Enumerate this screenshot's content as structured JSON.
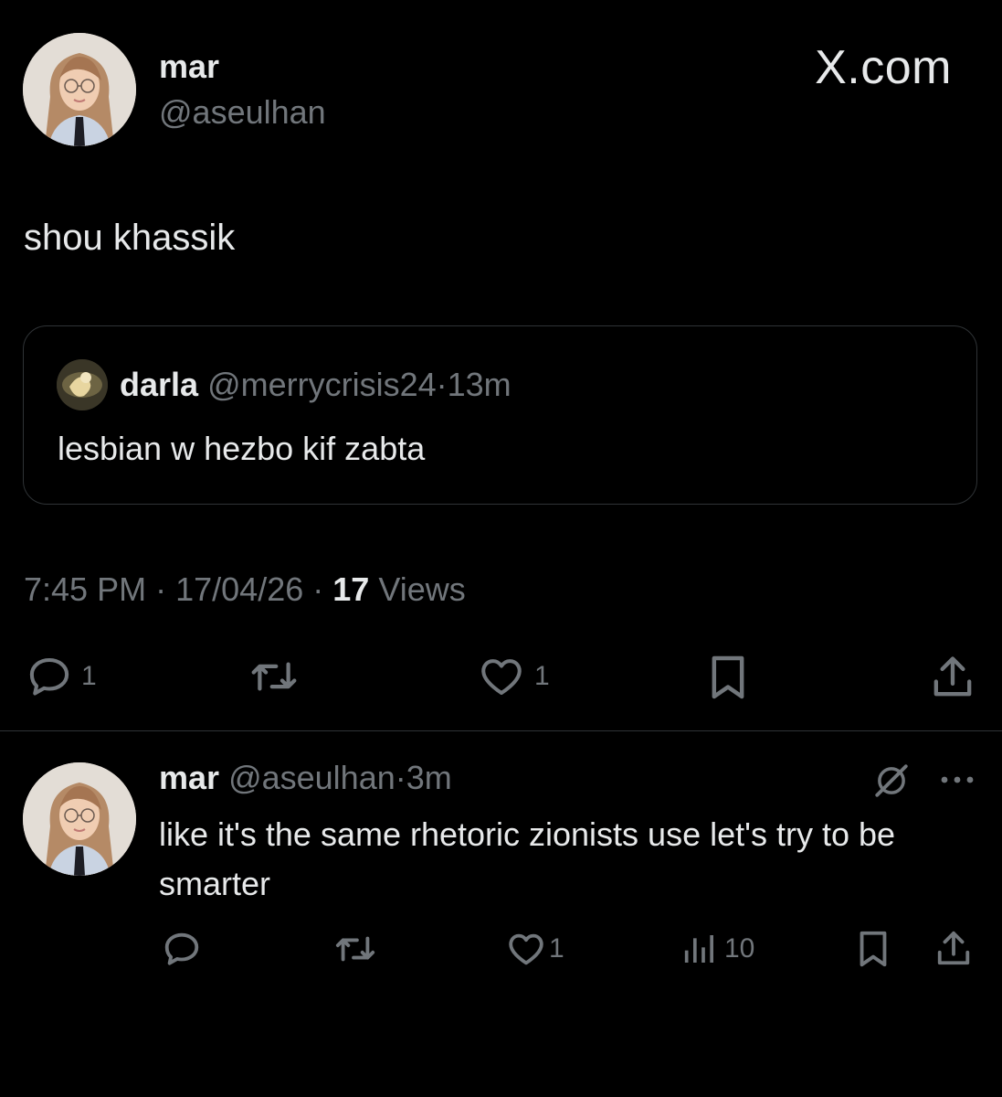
{
  "brand": {
    "logo_text": "X.com"
  },
  "post": {
    "author_name": "mar",
    "author_handle": "@aseulhan",
    "text": "shou khassik",
    "quoted": {
      "author_name": "darla",
      "author_handle": "@merrycrisis24",
      "separator": "·",
      "time": "13m",
      "text": "lesbian w hezbo kif zabta"
    },
    "meta": {
      "time": "7:45 PM",
      "separator": "·",
      "date": "17/04/26",
      "views_count": "17",
      "views_label": "Views"
    },
    "actions": {
      "reply_count": "1",
      "like_count": "1"
    }
  },
  "reply": {
    "author_name": "mar",
    "author_handle": "@aseulhan",
    "separator": "·",
    "time": "3m",
    "text": "like it's the same rhetoric zionists use let's try to be smarter",
    "actions": {
      "like_count": "1",
      "views_count": "10"
    }
  },
  "icons": {
    "reply": "reply-bubble-icon",
    "retweet": "retweet-icon",
    "like": "heart-icon",
    "bookmark": "bookmark-icon",
    "share": "share-icon",
    "views": "views-bar-chart-icon",
    "grok": "grok-icon",
    "more": "more-dots-icon"
  },
  "colors": {
    "background": "#000000",
    "text_primary": "#e7e9ea",
    "text_secondary": "#71767b",
    "border": "#2f3336"
  }
}
